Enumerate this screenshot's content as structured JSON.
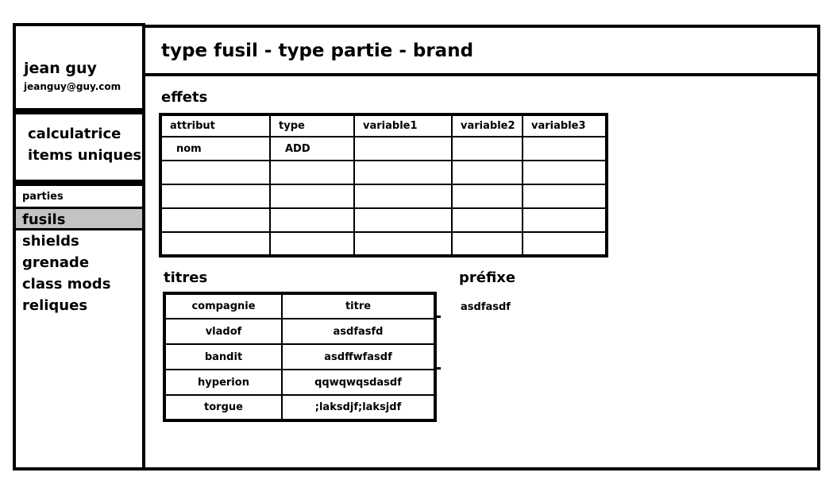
{
  "user": {
    "name": "jean guy",
    "email": "jeanguy@guy.com"
  },
  "tools": [
    "calculatrice",
    "items uniques"
  ],
  "nav": {
    "section": "parties",
    "items": [
      "fusils",
      "shields",
      "grenade",
      "class mods",
      "reliques"
    ],
    "active": "fusils"
  },
  "header": {
    "title": "type fusil - type partie - brand"
  },
  "effets": {
    "heading": "effets",
    "columns": [
      "attribut",
      "type",
      "variable1",
      "variable2",
      "variable3"
    ],
    "rows": [
      [
        "nom",
        "ADD",
        "",
        "",
        ""
      ],
      [
        "",
        "",
        "",
        "",
        ""
      ],
      [
        "",
        "",
        "",
        "",
        ""
      ],
      [
        "",
        "",
        "",
        "",
        ""
      ],
      [
        "",
        "",
        "",
        "",
        ""
      ]
    ]
  },
  "titres": {
    "heading": "titres",
    "columns": [
      "compagnie",
      "titre"
    ],
    "rows": [
      [
        "vladof",
        "asdfasfd"
      ],
      [
        "bandit",
        "asdffwfasdf"
      ],
      [
        "hyperion",
        "qqwqwqsdasdf"
      ],
      [
        "torgue",
        ";laksdjf;laksjdf"
      ]
    ]
  },
  "prefixe": {
    "heading": "préfixe",
    "value": "asdfasdf"
  }
}
